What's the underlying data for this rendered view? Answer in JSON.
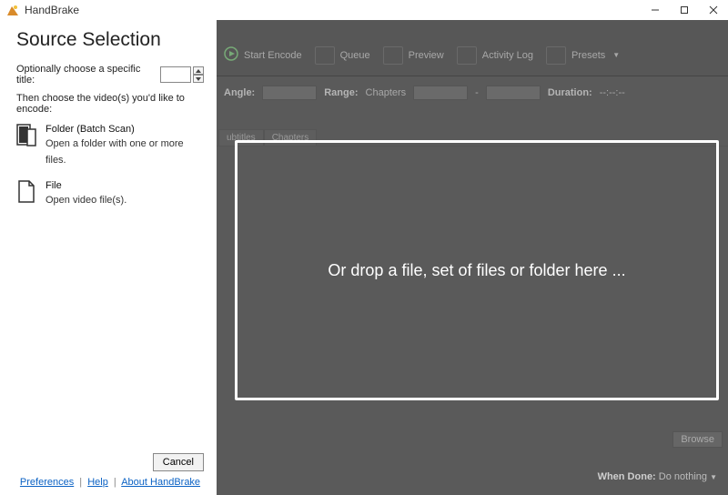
{
  "titlebar": {
    "title": "HandBrake"
  },
  "source": {
    "heading": "Source Selection",
    "optional_label": "Optionally choose a specific title:",
    "title_number": "",
    "then_label": "Then choose the video(s) you'd like to encode:",
    "options": [
      {
        "title": "Folder (Batch Scan)",
        "subtitle": "Open a folder with one or more files."
      },
      {
        "title": "File",
        "subtitle": "Open video file(s)."
      }
    ],
    "cancel": "Cancel",
    "links": {
      "preferences": "Preferences",
      "help": "Help",
      "about": "About HandBrake"
    }
  },
  "toolbar": {
    "start_encode": "Start Encode",
    "queue": "Queue",
    "preview": "Preview",
    "activity": "Activity Log",
    "presets": "Presets"
  },
  "config": {
    "angle_label": "Angle:",
    "range_label": "Range:",
    "range_value": "Chapters",
    "range_sep": "-",
    "duration_label": "Duration:",
    "duration_value": "--:--:--"
  },
  "tabs": {
    "subtitles": "ubtitles",
    "chapters": "Chapters"
  },
  "browse": "Browse",
  "when_done": {
    "label": "When Done:",
    "value": "Do nothing"
  },
  "dropzone": "Or drop a file, set of files or folder here ..."
}
